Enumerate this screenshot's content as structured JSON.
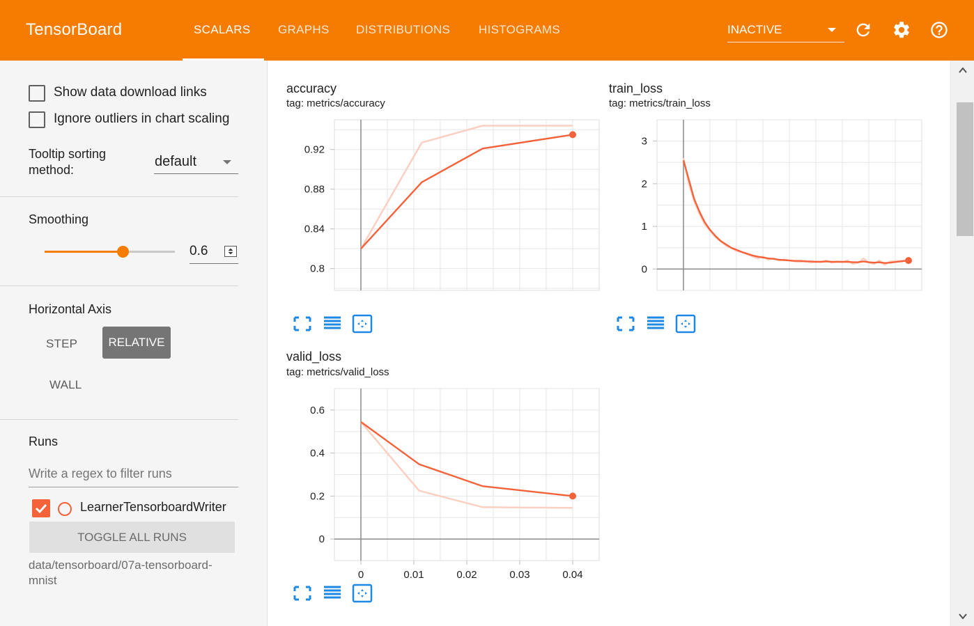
{
  "app": {
    "title": "TensorBoard"
  },
  "tabs": [
    {
      "label": "SCALARS",
      "active": true
    },
    {
      "label": "GRAPHS",
      "active": false
    },
    {
      "label": "DISTRIBUTIONS",
      "active": false
    },
    {
      "label": "HISTOGRAMS",
      "active": false
    }
  ],
  "run_status": {
    "value": "INACTIVE"
  },
  "top_icons": [
    "refresh-icon",
    "settings-icon",
    "help-icon"
  ],
  "colors": {
    "header": "#f57c00",
    "run": "#f4623a",
    "run_faded": "#fbd0c2",
    "button_selected": "#757575"
  },
  "sidebar": {
    "show_download_links": {
      "label": "Show data download links",
      "checked": false
    },
    "ignore_outliers": {
      "label": "Ignore outliers in chart scaling",
      "checked": false
    },
    "tooltip_sorting": {
      "label_line1": "Tooltip sorting",
      "label_line2": "method:",
      "value": "default"
    },
    "smoothing": {
      "title": "Smoothing",
      "value": "0.6",
      "fraction": 0.6
    },
    "horizontal_axis": {
      "title": "Horizontal Axis",
      "step": "STEP",
      "relative": "RELATIVE",
      "wall": "WALL",
      "selected": "RELATIVE"
    },
    "runs": {
      "title": "Runs",
      "filter_placeholder": "Write a regex to filter runs",
      "items": [
        {
          "name": "LearnerTensorboardWriter",
          "checked": true
        }
      ],
      "toggle_label": "TOGGLE ALL RUNS",
      "logdir": "data/tensorboard/07a-tensorboard-mnist"
    }
  },
  "cards": {
    "accuracy": {
      "title": "accuracy",
      "tag": "tag: metrics/accuracy"
    },
    "train_loss": {
      "title": "train_loss",
      "tag": "tag: metrics/train_loss"
    },
    "valid_loss": {
      "title": "valid_loss",
      "tag": "tag: metrics/valid_loss"
    }
  },
  "card_icons": [
    "fullscreen-icon",
    "toggle-y-log-icon",
    "fit-domain-icon"
  ],
  "chart_data": [
    {
      "type": "line",
      "title": "accuracy",
      "xlim": [
        -0.005,
        0.045
      ],
      "ylim": [
        0.778,
        0.95
      ],
      "yticks": [
        0.8,
        0.84,
        0.88,
        0.92
      ],
      "ytick_labels": [
        "0.8",
        "0.84",
        "0.88",
        "0.92"
      ],
      "grid": true,
      "series": [
        {
          "role": "raw",
          "x": [
            0,
            0.0115,
            0.023,
            0.04
          ],
          "y": [
            0.82,
            0.927,
            0.944,
            0.944
          ]
        },
        {
          "role": "smoothed",
          "x": [
            0,
            0.0115,
            0.023,
            0.04
          ],
          "y": [
            0.82,
            0.887,
            0.921,
            0.935
          ]
        }
      ]
    },
    {
      "type": "line",
      "title": "train_loss",
      "xlim": [
        -0.005,
        0.045
      ],
      "ylim": [
        -0.5,
        3.5
      ],
      "yticks": [
        0,
        1,
        2,
        3
      ],
      "ytick_labels": [
        "0",
        "1",
        "2",
        "3"
      ],
      "grid": true,
      "series": [
        {
          "role": "raw",
          "x": [
            0,
            0.001,
            0.002,
            0.003,
            0.004,
            0.005,
            0.006,
            0.007,
            0.008,
            0.009,
            0.01,
            0.011,
            0.012,
            0.013,
            0.014,
            0.015,
            0.016,
            0.017,
            0.018,
            0.019,
            0.02,
            0.021,
            0.022,
            0.023,
            0.024,
            0.025,
            0.026,
            0.027,
            0.028,
            0.029,
            0.03,
            0.031,
            0.032,
            0.033,
            0.034,
            0.035,
            0.036,
            0.037,
            0.038,
            0.039,
            0.0425
          ],
          "y": [
            2.6,
            2.0,
            1.6,
            1.3,
            1.05,
            0.9,
            0.75,
            0.65,
            0.55,
            0.5,
            0.42,
            0.4,
            0.35,
            0.3,
            0.25,
            0.3,
            0.22,
            0.25,
            0.2,
            0.22,
            0.2,
            0.18,
            0.17,
            0.2,
            0.15,
            0.18,
            0.17,
            0.2,
            0.15,
            0.18,
            0.16,
            0.2,
            0.12,
            0.15,
            0.25,
            0.15,
            0.12,
            0.2,
            0.1,
            0.18,
            0.2
          ]
        },
        {
          "role": "smoothed",
          "x": [
            0,
            0.001,
            0.002,
            0.003,
            0.004,
            0.005,
            0.006,
            0.007,
            0.008,
            0.009,
            0.01,
            0.011,
            0.012,
            0.013,
            0.014,
            0.015,
            0.016,
            0.017,
            0.018,
            0.019,
            0.02,
            0.021,
            0.022,
            0.023,
            0.024,
            0.025,
            0.026,
            0.027,
            0.028,
            0.029,
            0.03,
            0.031,
            0.032,
            0.033,
            0.034,
            0.035,
            0.036,
            0.037,
            0.038,
            0.039,
            0.0425
          ],
          "y": [
            2.55,
            2.1,
            1.65,
            1.35,
            1.1,
            0.92,
            0.78,
            0.66,
            0.58,
            0.5,
            0.45,
            0.4,
            0.36,
            0.32,
            0.29,
            0.27,
            0.25,
            0.24,
            0.22,
            0.21,
            0.2,
            0.19,
            0.19,
            0.18,
            0.18,
            0.17,
            0.17,
            0.18,
            0.17,
            0.17,
            0.17,
            0.17,
            0.16,
            0.16,
            0.18,
            0.16,
            0.15,
            0.16,
            0.14,
            0.15,
            0.2
          ]
        }
      ]
    },
    {
      "type": "line",
      "title": "valid_loss",
      "xlim": [
        -0.005,
        0.045
      ],
      "ylim": [
        -0.1,
        0.7
      ],
      "yticks": [
        0,
        0.2,
        0.4,
        0.6
      ],
      "ytick_labels": [
        "0",
        "0.2",
        "0.4",
        "0.6"
      ],
      "xticks": [
        0,
        0.01,
        0.02,
        0.03,
        0.04
      ],
      "xtick_labels": [
        "0",
        "0.01",
        "0.02",
        "0.03",
        "0.04"
      ],
      "grid": true,
      "series": [
        {
          "role": "raw",
          "x": [
            0,
            0.011,
            0.023,
            0.04
          ],
          "y": [
            0.545,
            0.225,
            0.148,
            0.145
          ]
        },
        {
          "role": "smoothed",
          "x": [
            0,
            0.011,
            0.023,
            0.04
          ],
          "y": [
            0.545,
            0.348,
            0.246,
            0.2
          ]
        }
      ]
    }
  ]
}
